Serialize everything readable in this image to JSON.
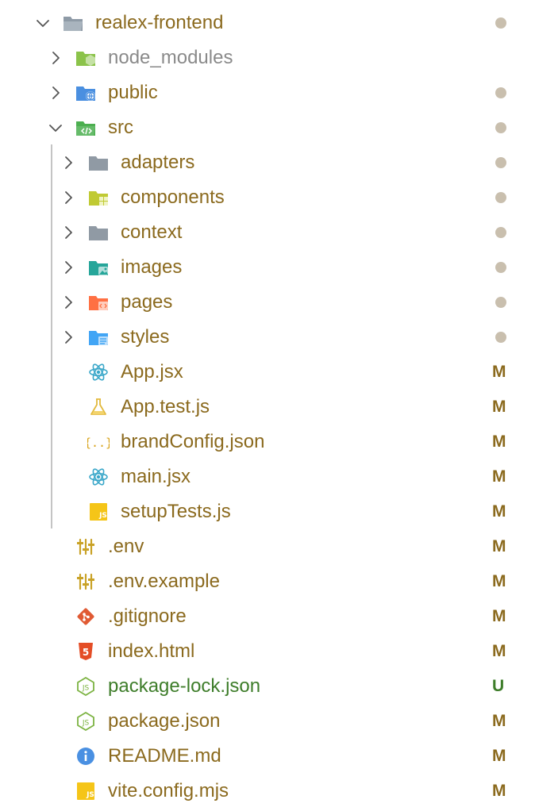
{
  "colors": {
    "modified": "#8b6a1e",
    "untracked": "#3e7d2a",
    "ignored": "#8a8a8a",
    "dot": "#c9bfae",
    "badge_modified": "#8b6a1e",
    "badge_untracked": "#3e7d2a"
  },
  "explorer": {
    "root": {
      "name": "realex-frontend",
      "icon": "folder-open-icon",
      "expanded": true,
      "status": "dot"
    },
    "items": [
      {
        "name": "node_modules",
        "icon": "folder-node-icon",
        "expanded": false,
        "status": ""
      },
      {
        "name": "public",
        "icon": "folder-public-icon",
        "expanded": false,
        "status": "dot"
      },
      {
        "name": "src",
        "icon": "folder-src-icon",
        "expanded": true,
        "status": "dot"
      },
      {
        "name": "adapters",
        "icon": "folder-icon",
        "expanded": false,
        "status": "dot"
      },
      {
        "name": "components",
        "icon": "folder-components-icon",
        "expanded": false,
        "status": "dot"
      },
      {
        "name": "context",
        "icon": "folder-icon",
        "expanded": false,
        "status": "dot"
      },
      {
        "name": "images",
        "icon": "folder-images-icon",
        "expanded": false,
        "status": "dot"
      },
      {
        "name": "pages",
        "icon": "folder-pages-icon",
        "expanded": false,
        "status": "dot"
      },
      {
        "name": "styles",
        "icon": "folder-styles-icon",
        "expanded": false,
        "status": "dot"
      },
      {
        "name": "App.jsx",
        "icon": "react-icon",
        "status": "M"
      },
      {
        "name": "App.test.js",
        "icon": "test-flask-icon",
        "status": "M"
      },
      {
        "name": "brandConfig.json",
        "icon": "json-braces-icon",
        "status": "M"
      },
      {
        "name": "main.jsx",
        "icon": "react-icon",
        "status": "M"
      },
      {
        "name": "setupTests.js",
        "icon": "js-icon",
        "status": "M"
      },
      {
        "name": ".env",
        "icon": "env-settings-icon",
        "status": "M"
      },
      {
        "name": ".env.example",
        "icon": "env-settings-icon",
        "status": "M"
      },
      {
        "name": ".gitignore",
        "icon": "git-icon",
        "status": "M"
      },
      {
        "name": "index.html",
        "icon": "html5-icon",
        "status": "M"
      },
      {
        "name": "package-lock.json",
        "icon": "nodejs-icon",
        "status": "U"
      },
      {
        "name": "package.json",
        "icon": "nodejs-icon",
        "status": "M"
      },
      {
        "name": "README.md",
        "icon": "info-icon",
        "status": "M"
      },
      {
        "name": "vite.config.mjs",
        "icon": "js-icon",
        "status": "M"
      }
    ]
  }
}
